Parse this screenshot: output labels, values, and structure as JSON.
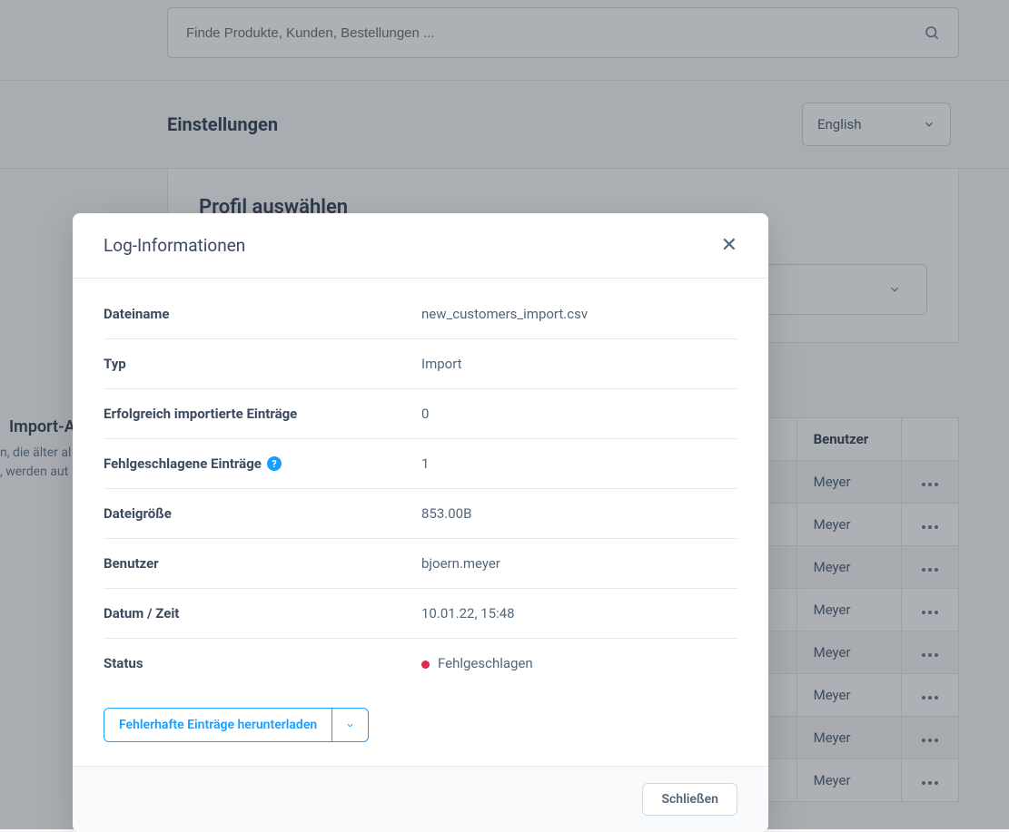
{
  "header": {
    "search_placeholder": "Finde Produkte, Kunden, Bestellungen ...",
    "page_title": "Einstellungen",
    "language": "English"
  },
  "profile": {
    "heading": "Profil auswählen"
  },
  "sidebar_fragment": {
    "heading": "Import-A",
    "line1": "n, die älter al",
    "line2": ", werden aut"
  },
  "table": {
    "header_user": "Benutzer",
    "rows": [
      {
        "user": "Meyer"
      },
      {
        "user": "Meyer"
      },
      {
        "user": "Meyer"
      },
      {
        "user": "Meyer"
      },
      {
        "user": "Meyer"
      },
      {
        "user": "Meyer"
      },
      {
        "user": "Meyer"
      },
      {
        "user": "Meyer"
      }
    ]
  },
  "modal": {
    "title": "Log-Informationen",
    "labels": {
      "filename": "Dateiname",
      "type": "Typ",
      "success": "Erfolgreich importierte Einträge",
      "failed": "Fehlgeschlagene Einträge",
      "filesize": "Dateigröße",
      "user": "Benutzer",
      "datetime": "Datum / Zeit",
      "status": "Status"
    },
    "values": {
      "filename": "new_customers_import.csv",
      "type": "Import",
      "success": "0",
      "failed": "1",
      "filesize": "853.00B",
      "user": "bjoern.meyer",
      "datetime": "10.01.22, 15:48",
      "status": "Fehlgeschlagen"
    },
    "download_btn": "Fehlerhafte Einträge herunterladen",
    "close_btn": "Schließen"
  },
  "colors": {
    "accent": "#189eff",
    "error": "#de294c"
  }
}
